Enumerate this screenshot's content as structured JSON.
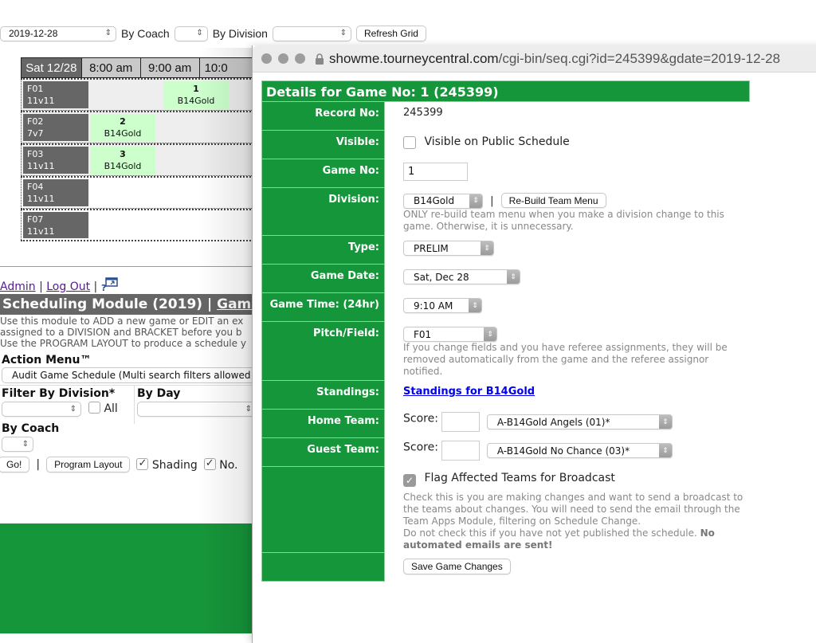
{
  "toolbar": {
    "date_value": "2019-12-28",
    "by_coach_label": "By Coach",
    "coach_value": "",
    "by_division_label": "By Division",
    "division_value": "",
    "refresh_label": "Refresh Grid"
  },
  "grid": {
    "day_header": "Sat 12/28",
    "time_headers": [
      "8:00 am",
      "9:00 am",
      "10:0"
    ],
    "rows": [
      {
        "field": "F01",
        "format": "11v11"
      },
      {
        "field": "F02",
        "format": "7v7"
      },
      {
        "field": "F03",
        "format": "11v11"
      },
      {
        "field": "F04",
        "format": "11v11"
      },
      {
        "field": "F07",
        "format": "11v11"
      }
    ],
    "games": [
      {
        "no": "1",
        "division": "B14Gold",
        "field": "F01",
        "slot": "9:00 am"
      },
      {
        "no": "2",
        "division": "B14Gold",
        "field": "F02",
        "slot": "8:00 am"
      },
      {
        "no": "3",
        "division": "B14Gold",
        "field": "F03",
        "slot": "8:00 am"
      }
    ]
  },
  "nav": {
    "admin": "Admin",
    "logout": "Log Out",
    "separator": "|"
  },
  "module": {
    "title": "Scheduling Module (2019) | ",
    "title_link": "Game",
    "desc": [
      "Use this module to ADD a new game or EDIT an ex",
      "assigned to a DIVISION and BRACKET before you b",
      "Use the PROGRAM LAYOUT to produce a schedule y"
    ],
    "action_menu_title": "Action Menu™",
    "action_menu_value": "Audit Game Schedule (Multi search filters allowed",
    "filter_division_label": "Filter By Division*",
    "all_label": "All",
    "by_day_label": "By Day",
    "by_coach_label": "By Coach",
    "go_label": "Go!",
    "program_layout_label": "Program Layout",
    "shading_label": "Shading",
    "no_label": "No."
  },
  "popup": {
    "url_domain": "showme.tourneycentral.com",
    "url_path": "/cgi-bin/seq.cgi?id=245399&gdate=2019-12-28",
    "title": "Details for Game No: 1 (245399)",
    "record_no_label": "Record No:",
    "record_no": "245399",
    "visible_label": "Visible:",
    "visible_checkbox_label": "Visible on Public Schedule",
    "visible_checked": false,
    "game_no_label": "Game No:",
    "game_no_value": "1",
    "division_label": "Division:",
    "division_value": "B14Gold",
    "rebuild_label": "Re-Build Team Menu",
    "division_note": "ONLY re-build team menu when you make a division change to this game. Otherwise, it is unnecessary.",
    "type_label": "Type:",
    "type_value": "PRELIM",
    "game_date_label": "Game Date:",
    "game_date_value": "Sat, Dec 28",
    "game_time_label": "Game Time: (24hr)",
    "game_time_value": "9:10 AM",
    "field_label": "Pitch/Field:",
    "field_value": "F01",
    "field_note": "If you change fields and you have referee assignments, they will be removed automatically from the game and the referee assignor notified.",
    "standings_label": "Standings:",
    "standings_link": "Standings for B14Gold",
    "home_label": "Home Team:",
    "guest_label": "Guest Team:",
    "score_label": "Score:",
    "home_score": "",
    "guest_score": "",
    "home_team": "A-B14Gold Angels (01)*",
    "guest_team": "A-B14Gold No Chance (03)*",
    "flag_label": "Flag Affected Teams for Broadcast",
    "flag_checked": true,
    "flag_note_1": "Check this is you are making changes and want to send a broadcast to the teams about changes. You will need to send the email through the Team Apps Module, filtering on Schedule Change.",
    "flag_note_2": "Do not check this if you have not yet published the schedule. ",
    "flag_note_bold": "No automated emails are sent!",
    "save_label": "Save Game Changes"
  },
  "colors": {
    "brand_green": "#16963a",
    "field_gray": "#666666",
    "game_green": "#ccffcc"
  }
}
